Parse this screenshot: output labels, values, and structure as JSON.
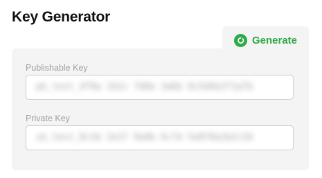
{
  "header": {
    "title": "Key Generator"
  },
  "actions": {
    "generate_label": "Generate",
    "generate_icon": "refresh-icon",
    "accent_color": "#2eaa4a"
  },
  "fields": {
    "publishable": {
      "label": "Publishable Key",
      "value": "pk_test_4f9a 1b2c 7d8e 3a6b 0c5d9e2f1a7b"
    },
    "private": {
      "label": "Private Key",
      "value": "sk_test_8c3d 2e1f 9a4b 6c7d 5e8f0a1b2c3d"
    }
  }
}
